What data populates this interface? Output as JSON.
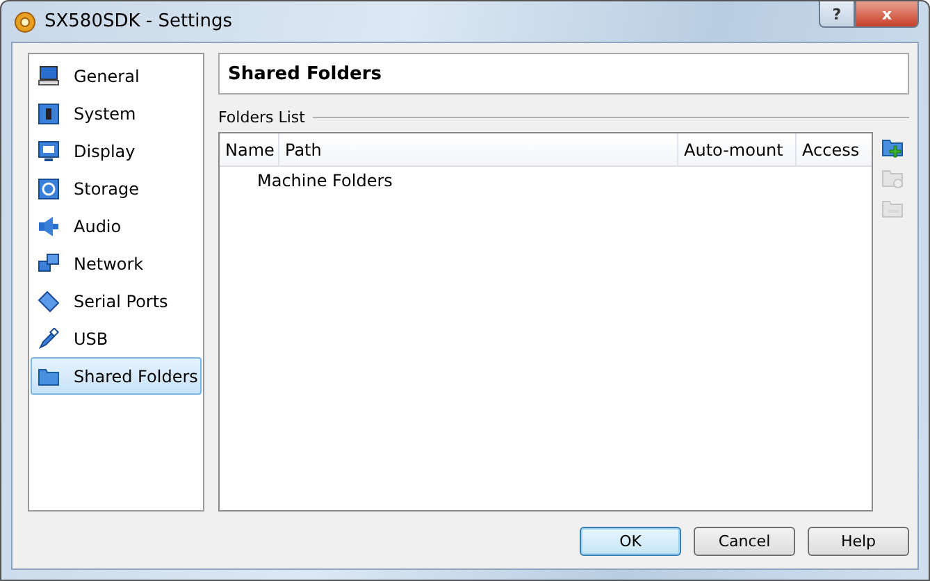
{
  "window": {
    "title": "SX580SDK - Settings",
    "controls": [
      "?",
      "x"
    ]
  },
  "sidebar": {
    "items": [
      {
        "label": "General",
        "selected": false
      },
      {
        "label": "System",
        "selected": false
      },
      {
        "label": "Display",
        "selected": false
      },
      {
        "label": "Storage",
        "selected": false
      },
      {
        "label": "Audio",
        "selected": false
      },
      {
        "label": "Network",
        "selected": false
      },
      {
        "label": "Serial Ports",
        "selected": false
      },
      {
        "label": "USB",
        "selected": false
      },
      {
        "label": "Shared Folders",
        "selected": true
      }
    ]
  },
  "page_title": "Shared Folders",
  "folders_list": {
    "label": "Folders List",
    "table": {
      "columns": [
        "Name",
        "Path",
        "Auto-mount",
        "Access"
      ],
      "groups": [
        {
          "label": "Machine Folders"
        }
      ]
    },
    "tools": [
      {
        "kind": "add",
        "disabled": false
      },
      {
        "kind": "edit",
        "disabled": true
      },
      {
        "kind": "remove",
        "disabled": true
      }
    ]
  },
  "buttons": [
    {
      "label": "OK",
      "default": true
    },
    {
      "label": "Cancel",
      "default": false
    },
    {
      "label": "Help",
      "default": false
    }
  ]
}
